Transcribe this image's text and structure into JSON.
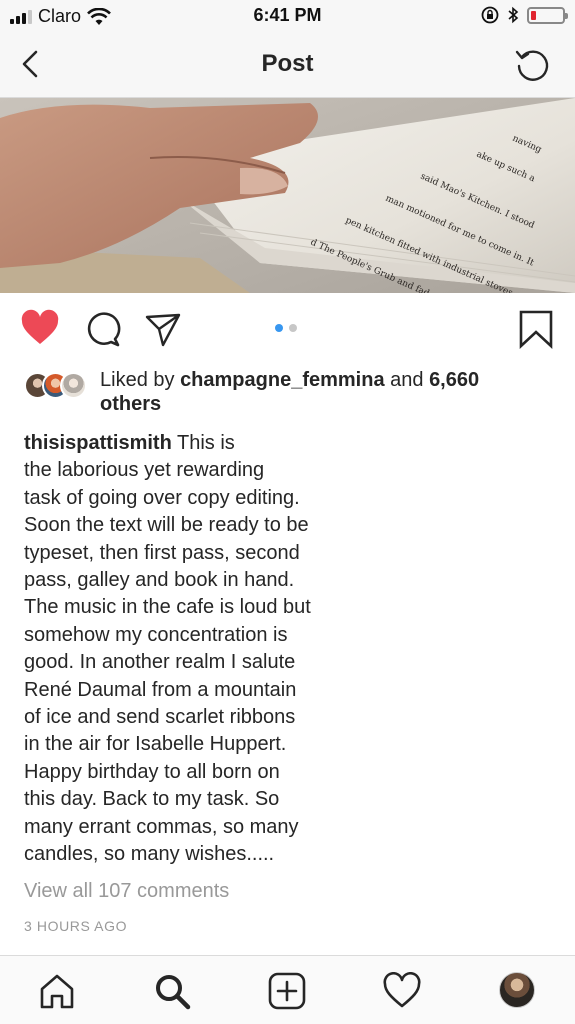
{
  "status_bar": {
    "carrier": "Claro",
    "time": "6:41 PM",
    "battery_level": 0.15,
    "battery_color": "#e0242f"
  },
  "nav": {
    "title": "Post",
    "back_icon": "chevron-left-icon",
    "refresh_icon": "refresh-icon"
  },
  "photo": {
    "page_lines": [
      "naving",
      "ake up such a",
      "said Mao's Kitchen. I stood",
      "man motioned for me to come in. It",
      "pen kitchen fitted with industrial stoves and",
      "d The People's Grub and faded posters of rice fields"
    ]
  },
  "actions": {
    "liked": true,
    "like_color": "#ed4956",
    "carousel_index": 1,
    "carousel_count": 2,
    "accent": "#3897f0"
  },
  "likes": {
    "prefix": "Liked by ",
    "user": "champagne_femmina",
    "middle": " and ",
    "count": "6,660",
    "suffix_line2": "others"
  },
  "caption": {
    "username": "thisispattismith",
    "text": " This is\nthe laborious yet rewarding\ntask of going over copy editing.\nSoon the text will be ready to be\ntypeset, then first pass, second\npass, galley and book in hand.\nThe music in the cafe is loud but\nsomehow my concentration is\ngood. In another realm I salute\nRené Daumal from a mountain\nof ice and send scarlet ribbons\nin the air for Isabelle Huppert.\nHappy birthday to all born on\nthis day. Back to my task. So\nmany errant commas, so many\ncandles, so many wishes....."
  },
  "comments": {
    "view_all": "View all 107 comments",
    "timestamp": "3 HOURS AGO"
  },
  "tabbar": {
    "items": [
      "home-icon",
      "search-icon",
      "add-post-icon",
      "activity-heart-icon",
      "profile-avatar"
    ]
  }
}
